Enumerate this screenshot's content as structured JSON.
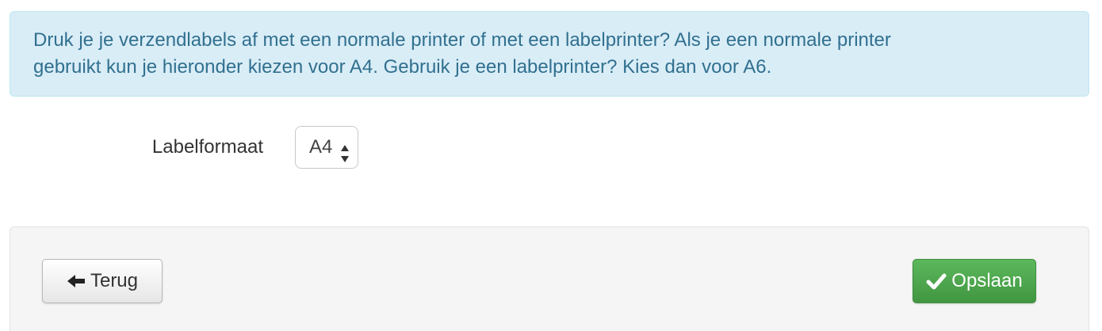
{
  "alert": {
    "line1": "Druk je je verzendlabels af met een normale printer of met een labelprinter? Als je een normale printer",
    "line2": "gebruikt kun je hieronder kiezen voor A4. Gebruik je een labelprinter? Kies dan voor A6."
  },
  "form": {
    "label": "Labelformaat",
    "select_value": "A4"
  },
  "footer": {
    "back_label": "Terug",
    "save_label": "Opslaan"
  },
  "colors": {
    "alert_bg": "#d9edf7",
    "alert_text": "#31708f",
    "success": "#5cb85c"
  },
  "icons": {
    "back": "arrow-left-icon",
    "save": "checkmark-icon",
    "select": "select-arrows-icon"
  }
}
